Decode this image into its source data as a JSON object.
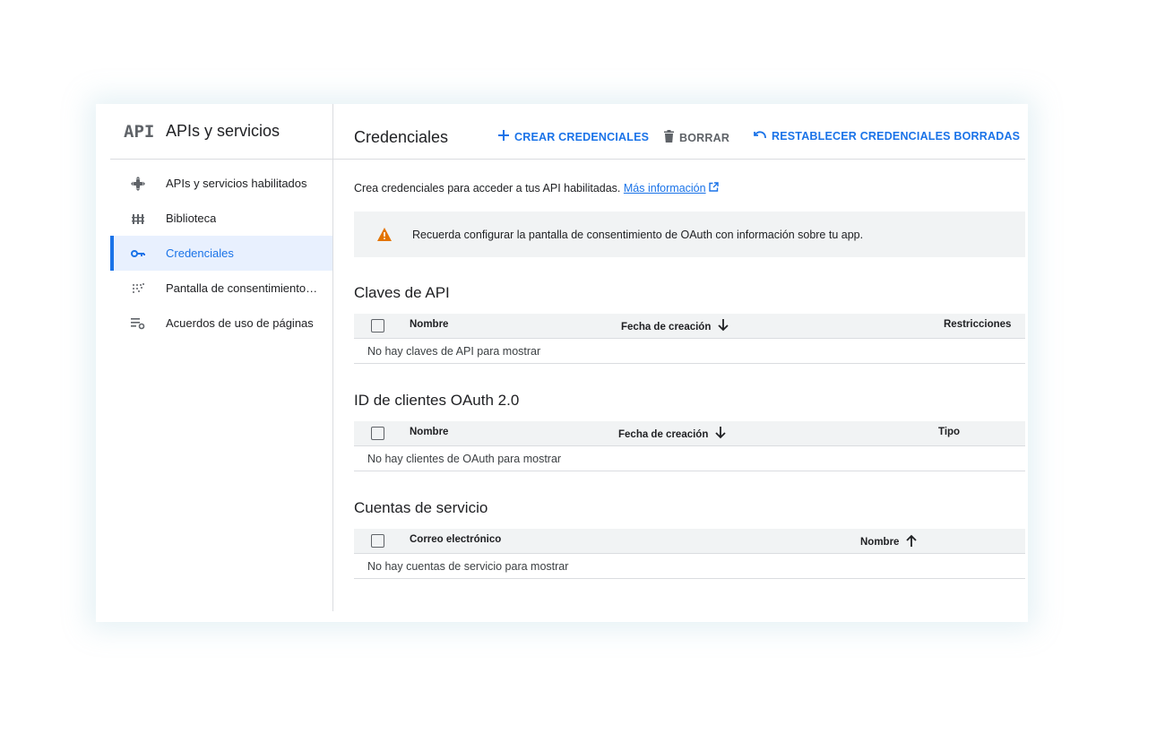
{
  "sidebar": {
    "logo": "API",
    "title": "APIs y servicios",
    "items": [
      {
        "label": "APIs y servicios habilitados",
        "icon": "diamond-arrows-icon",
        "active": false
      },
      {
        "label": "Biblioteca",
        "icon": "library-icon",
        "active": false
      },
      {
        "label": "Credenciales",
        "icon": "key-icon",
        "active": true
      },
      {
        "label": "Pantalla de consentimiento …",
        "icon": "dot-grid-icon",
        "active": false
      },
      {
        "label": "Acuerdos de uso de páginas",
        "icon": "list-settings-icon",
        "active": false
      }
    ]
  },
  "header": {
    "title": "Credenciales",
    "create_label": "CREAR CREDENCIALES",
    "delete_label": "BORRAR",
    "restore_label": "RESTABLECER CREDENCIALES BORRADAS"
  },
  "intro": {
    "text": "Crea credenciales para acceder a tus API habilitadas.",
    "link": "Más información"
  },
  "banner": {
    "text": "Recuerda configurar la pantalla de consentimiento de OAuth con información sobre tu app."
  },
  "api_keys": {
    "title": "Claves de API",
    "col_name": "Nombre",
    "col_date": "Fecha de creación",
    "col_restrictions": "Restricciones",
    "empty": "No hay claves de API para mostrar"
  },
  "oauth": {
    "title": "ID de clientes OAuth 2.0",
    "col_name": "Nombre",
    "col_date": "Fecha de creación",
    "col_type": "Tipo",
    "empty": "No hay clientes de OAuth para mostrar"
  },
  "service_accounts": {
    "title": "Cuentas de servicio",
    "col_email": "Correo electrónico",
    "col_name": "Nombre",
    "empty": "No hay cuentas de servicio para mostrar"
  },
  "colors": {
    "accent": "#1a73e8",
    "active_bg": "#e8f0fe",
    "warning": "#e37400",
    "header_bg": "#f1f3f4"
  }
}
